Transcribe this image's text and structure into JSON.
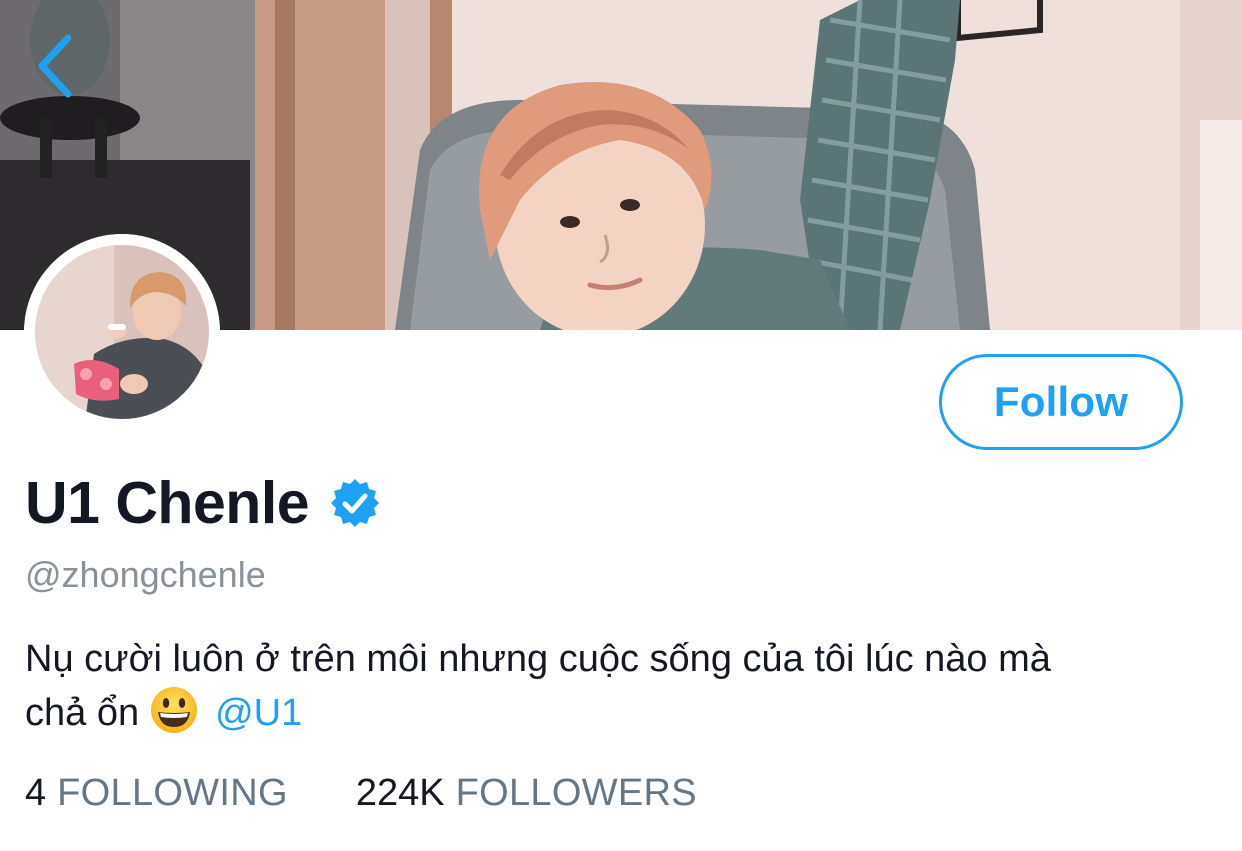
{
  "profile": {
    "display_name": "U1 Chenle",
    "verified": true,
    "handle": "@zhongchenle",
    "bio_line1": "Nụ cười luôn ở trên môi nhưng cuộc sống của tôi lúc nào mà",
    "bio_line2": "chả ổn",
    "bio_emoji": "grinning-face-emoji",
    "bio_mention": "@U1"
  },
  "actions": {
    "follow_label": "Follow",
    "back_icon": "chevron-left-icon"
  },
  "stats": {
    "following_count": "4",
    "following_label": "FOLLOWING",
    "followers_count": "224K",
    "followers_label": "FOLLOWERS"
  },
  "colors": {
    "accent": "#1da1f2",
    "text_primary": "#141823",
    "text_secondary": "#8a9199",
    "stat_label": "#657786"
  }
}
